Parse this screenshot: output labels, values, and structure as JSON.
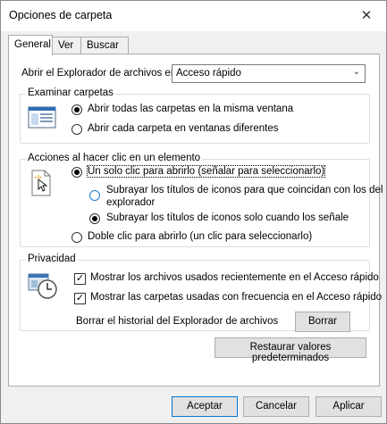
{
  "window": {
    "title": "Opciones de carpeta",
    "close_glyph": "✕"
  },
  "tabs": [
    {
      "label": "General"
    },
    {
      "label": "Ver"
    },
    {
      "label": "Buscar"
    }
  ],
  "general": {
    "open_explorer_label": "Abrir el Explorador de archivos en:",
    "open_explorer_value": "Acceso rápido",
    "browse": {
      "title": "Examinar carpetas",
      "option_same": "Abrir todas las carpetas en la misma ventana",
      "option_new": "Abrir cada carpeta en ventanas diferentes",
      "selected": "same"
    },
    "click": {
      "title": "Acciones al hacer clic en un elemento",
      "single": "Un solo clic para abrirlo (señalar para seleccionarlo)",
      "underline_consistent_line1": "Subrayar los títulos de iconos para que coincidan con los del",
      "underline_consistent_line2": "explorador",
      "underline_hover": "Subrayar los títulos de iconos solo cuando los señale",
      "double": "Doble clic para abrirlo (un clic para seleccionarlo)",
      "selected": "single",
      "underline_selected": "hover"
    },
    "privacy": {
      "title": "Privacidad",
      "recent_files": "Mostrar los archivos usados recientemente en el Acceso rápido",
      "frequent_folders": "Mostrar las carpetas usadas con frecuencia en el Acceso rápido",
      "recent_files_checked": true,
      "frequent_folders_checked": true,
      "clear_label": "Borrar el historial del Explorador de archivos",
      "clear_button": "Borrar"
    },
    "restore_button": "Restaurar valores predeterminados"
  },
  "footer": {
    "accept": "Aceptar",
    "cancel": "Cancelar",
    "apply": "Aplicar"
  },
  "icons": {
    "check": "✓",
    "dropdown": "⌄"
  }
}
